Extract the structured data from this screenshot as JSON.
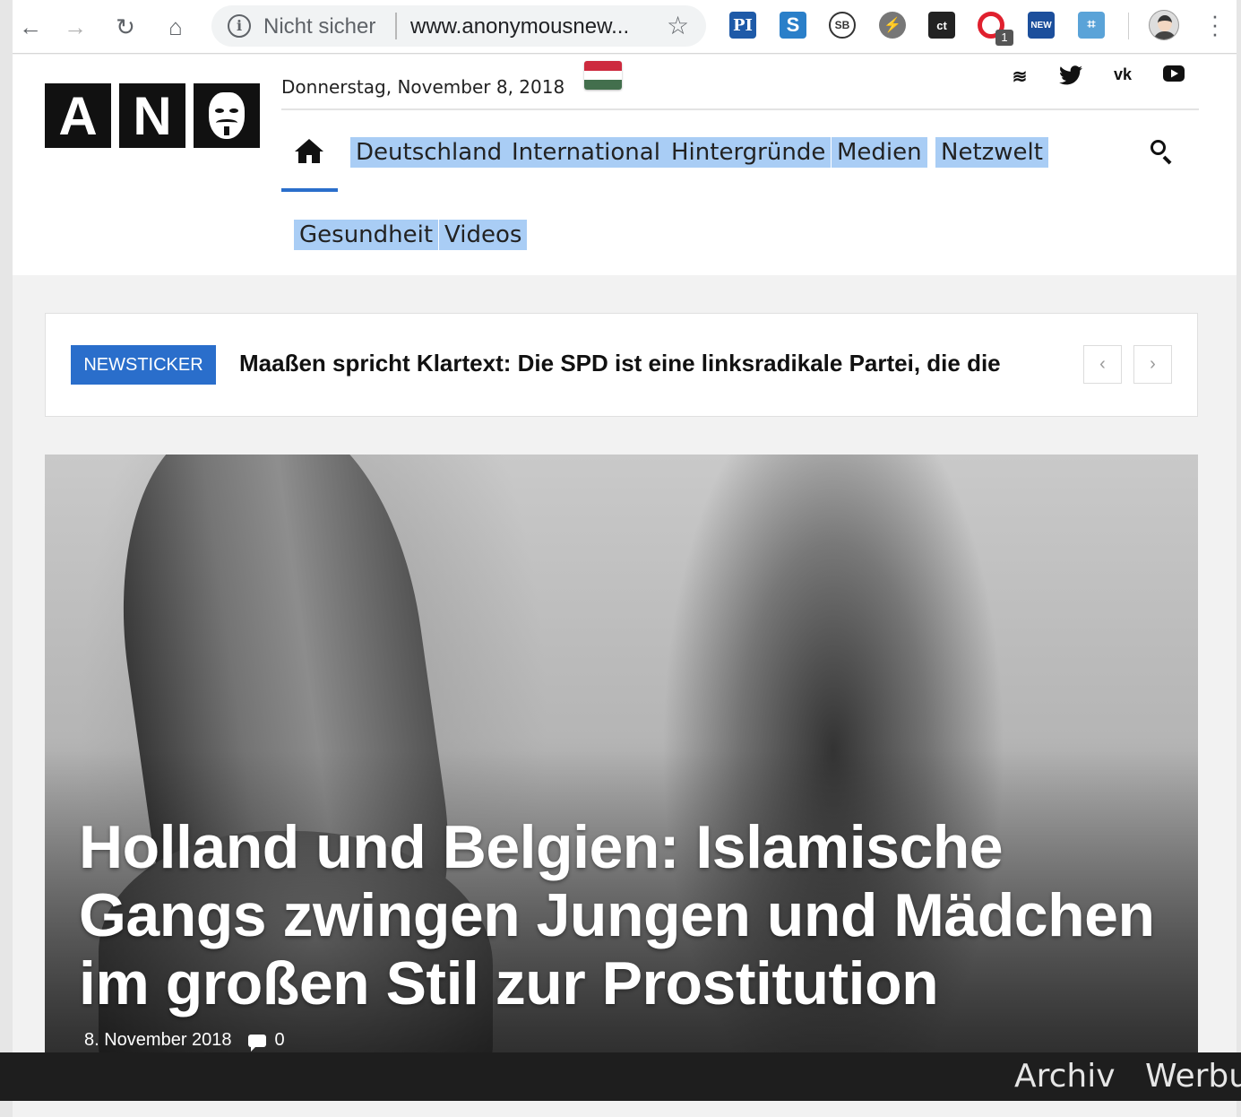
{
  "browser": {
    "insecure_label": "Nicht sicher",
    "url": "www.anonymousnew...",
    "extension_badge": "1",
    "extensions": [
      "pi-icon",
      "s-icon",
      "sb-icon",
      "bolt-icon",
      "ct-icon",
      "opera-icon",
      "new-icon",
      "rss-cast-icon"
    ]
  },
  "header": {
    "logo_letters": [
      "A",
      "N"
    ],
    "date": "Donnerstag, November 8, 2018",
    "flag_colors": [
      "#cd2a3e",
      "#ffffff",
      "#436f4d"
    ],
    "social_icons": [
      "rss-icon",
      "twitter-icon",
      "vk-icon",
      "youtube-icon"
    ],
    "nav": {
      "row1": [
        "Deutschland",
        "International",
        "Hintergründe",
        "Medien",
        "Netzwelt"
      ],
      "row2": [
        "Gesundheit",
        "Videos"
      ]
    },
    "accent_color": "#2a6ecb"
  },
  "ticker": {
    "label": "NEWSTICKER",
    "headline": "Maaßen spricht Klartext: Die SPD ist eine linksradikale Partei, die die"
  },
  "hero": {
    "title": "Holland und Belgien: Islamische Gangs zwingen Jungen und Mädchen im großen Stil zur Prostitution",
    "date": "8. November 2018",
    "comments": "0"
  },
  "footer_bar": {
    "links": [
      "Archiv",
      "Werbu"
    ]
  }
}
